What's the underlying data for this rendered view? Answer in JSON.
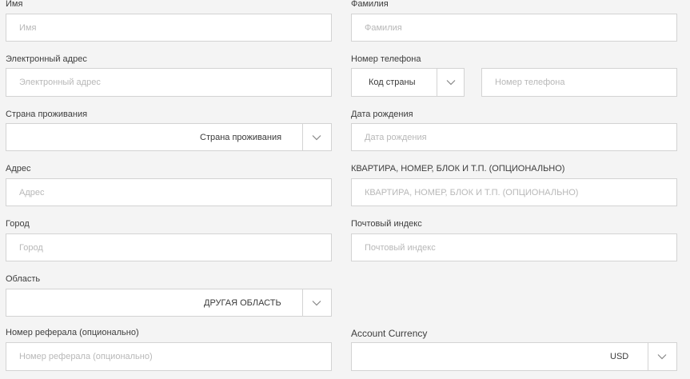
{
  "form": {
    "first_name": {
      "label": "Имя",
      "placeholder": "Имя"
    },
    "last_name": {
      "label": "Фамилия",
      "placeholder": "Фамилия"
    },
    "email": {
      "label": "Электронный адрес",
      "placeholder": "Электронный адрес"
    },
    "phone": {
      "label": "Номер телефона",
      "country_code_value": "Код страны",
      "placeholder": "Номер телефона"
    },
    "country": {
      "label": "Страна проживания",
      "value": "Страна проживания"
    },
    "birth_date": {
      "label": "Дата рождения",
      "placeholder": "Дата рождения"
    },
    "address": {
      "label": "Адрес",
      "placeholder": "Адрес"
    },
    "apartment": {
      "label": "КВАРТИРА, НОМЕР, БЛОК И Т.П. (ОПЦИОНАЛЬНО)",
      "placeholder": "КВАРТИРА, НОМЕР, БЛОК И Т.П. (ОПЦИОНАЛЬНО)"
    },
    "city": {
      "label": "Город",
      "placeholder": "Город"
    },
    "postal_code": {
      "label": "Почтовый индекс",
      "placeholder": "Почтовый индекс"
    },
    "region": {
      "label": "Область",
      "value": "ДРУГАЯ ОБЛАСТЬ"
    },
    "referral": {
      "label": "Номер реферала (опционально)",
      "placeholder": "Номер реферала (опционально)"
    },
    "currency": {
      "label": "Account Currency",
      "value": "USD"
    }
  },
  "icons": {
    "dropdown": "chevron-down-icon"
  },
  "colors": {
    "background": "#f4f4f4",
    "border": "#d3d3d3",
    "placeholder": "#b8b8b8",
    "text": "#3a3a3a"
  }
}
